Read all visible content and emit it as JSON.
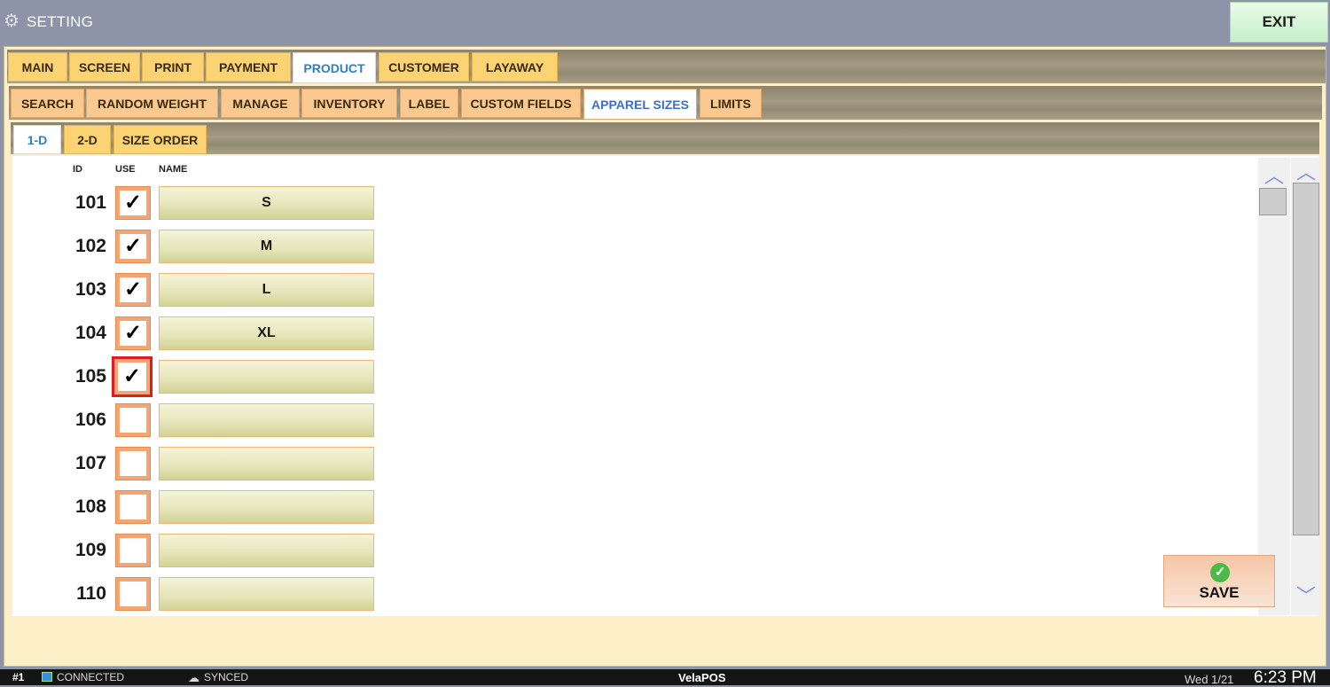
{
  "window": {
    "title": "SETTING",
    "exit_label": "EXIT",
    "settings_icon": "gear-icon"
  },
  "tabs": {
    "main": [
      {
        "label": "MAIN"
      },
      {
        "label": "SCREEN"
      },
      {
        "label": "PRINT"
      },
      {
        "label": "PAYMENT"
      },
      {
        "label": "PRODUCT",
        "active": true
      },
      {
        "label": "CUSTOMER"
      },
      {
        "label": "LAYAWAY"
      }
    ],
    "product": [
      {
        "label": "SEARCH"
      },
      {
        "label": "RANDOM WEIGHT"
      },
      {
        "label": "MANAGE"
      },
      {
        "label": "INVENTORY"
      },
      {
        "label": "LABEL"
      },
      {
        "label": "CUSTOM FIELDS"
      },
      {
        "label": "APPAREL SIZES",
        "active": true
      },
      {
        "label": "LIMITS"
      }
    ],
    "apparel": [
      {
        "label": "1-D",
        "active": true
      },
      {
        "label": "2-D"
      },
      {
        "label": "SIZE ORDER"
      }
    ]
  },
  "table": {
    "headers": {
      "id": "ID",
      "use": "USE",
      "name": "NAME"
    },
    "rows": [
      {
        "id": "101",
        "use": true,
        "name": "S"
      },
      {
        "id": "102",
        "use": true,
        "name": "M"
      },
      {
        "id": "103",
        "use": true,
        "name": "L"
      },
      {
        "id": "104",
        "use": true,
        "name": "XL"
      },
      {
        "id": "105",
        "use": true,
        "name": "",
        "focused": true
      },
      {
        "id": "106",
        "use": false,
        "name": ""
      },
      {
        "id": "107",
        "use": false,
        "name": ""
      },
      {
        "id": "108",
        "use": false,
        "name": ""
      },
      {
        "id": "109",
        "use": false,
        "name": ""
      },
      {
        "id": "110",
        "use": false,
        "name": ""
      }
    ]
  },
  "checkmark": "✓",
  "scroll": {
    "up": "︿",
    "down": "﹀"
  },
  "save": {
    "label": "SAVE",
    "icon_glyph": "✓"
  },
  "status": {
    "station": "#1",
    "connection": "CONNECTED",
    "sync": "SYNCED",
    "brand_prefix": "Vela",
    "brand_suffix": "POS",
    "date": "Wed 1/21",
    "time": "6:23 PM"
  },
  "colors": {
    "focus_border": "#d81e1e",
    "active_tab_text": "#2f7fc7",
    "save_check": "#4cba46"
  }
}
